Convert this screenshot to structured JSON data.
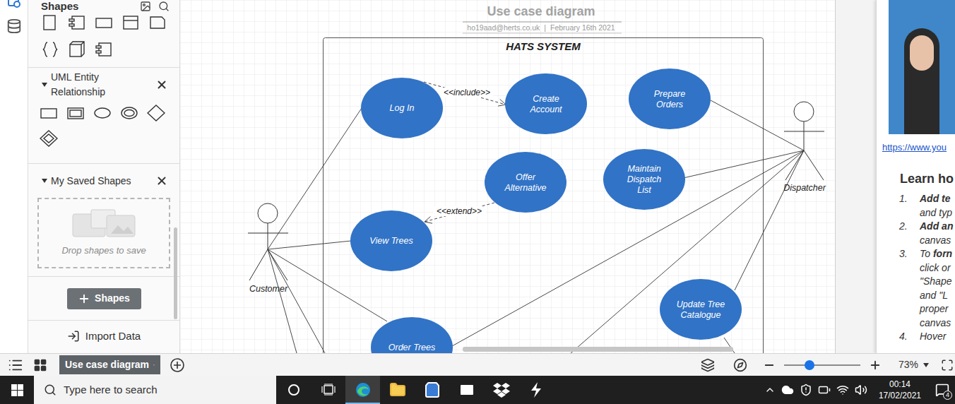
{
  "shapes_panel": {
    "title": "Shapes",
    "sections": [
      {
        "title": "UML Entity Relationship",
        "expanded": true
      },
      {
        "title": "My Saved Shapes",
        "expanded": true
      }
    ],
    "drop_zone": "Drop shapes to save",
    "add_button": "Shapes",
    "import": "Import Data"
  },
  "diagram": {
    "title": "Use case diagram",
    "author": "ho19aad@herts.co.uk",
    "separator": "|",
    "date": "February 16th 2021",
    "system": "HATS SYSTEM",
    "actors": [
      {
        "name": "Customer"
      },
      {
        "name": "Dispatcher"
      }
    ],
    "use_cases": [
      {
        "lines": [
          "Log In"
        ]
      },
      {
        "lines": [
          "Create",
          "Account"
        ]
      },
      {
        "lines": [
          "Prepare",
          "Orders"
        ]
      },
      {
        "lines": [
          "Offer",
          "Alternative"
        ]
      },
      {
        "lines": [
          "Maintain",
          "Dispatch",
          "List"
        ]
      },
      {
        "lines": [
          "View Trees"
        ]
      },
      {
        "lines": [
          "Update Tree",
          "Catalogue"
        ]
      },
      {
        "lines": [
          "Order Trees"
        ]
      }
    ],
    "relations": [
      {
        "kind": "include",
        "label": "<<include>>"
      },
      {
        "kind": "extend",
        "label": "<<extend>>"
      }
    ]
  },
  "right_panel": {
    "link": "https://www.you",
    "heading": "Learn ho",
    "steps": [
      {
        "number": "1.",
        "lines": [
          [
            {
              "text": "Add te",
              "bold": true
            }
          ],
          [
            {
              "text": "and typ",
              "bold": false
            }
          ]
        ]
      },
      {
        "number": "2.",
        "lines": [
          [
            {
              "text": "Add an",
              "bold": true
            }
          ],
          [
            {
              "text": "canvas",
              "bold": false
            }
          ]
        ]
      },
      {
        "number": "3.",
        "lines": [
          [
            {
              "text": "To ",
              "bold": false
            },
            {
              "text": "forn",
              "bold": true
            }
          ],
          [
            {
              "text": "click or",
              "bold": false
            }
          ],
          [
            {
              "text": "\"Shape",
              "bold": false
            }
          ],
          [
            {
              "text": "and \"L",
              "bold": false
            }
          ],
          [
            {
              "text": "proper",
              "bold": false
            }
          ],
          [
            {
              "text": "canvas",
              "bold": false
            }
          ]
        ]
      },
      {
        "number": "4.",
        "lines": [
          [
            {
              "text": "Hover",
              "bold": false
            }
          ]
        ]
      }
    ]
  },
  "bottom_bar": {
    "page_tab": "Use case diagram",
    "zoom": "73%",
    "zoom_level": 0.33
  },
  "taskbar": {
    "search_placeholder": "Type here to search",
    "apps": [
      {
        "kind": "cortana",
        "selected": false
      },
      {
        "kind": "taskview",
        "selected": false
      },
      {
        "kind": "edge",
        "selected": true
      },
      {
        "kind": "explorer",
        "selected": false
      },
      {
        "kind": "store",
        "selected": false
      },
      {
        "kind": "mail",
        "selected": false
      },
      {
        "kind": "dropbox",
        "selected": false
      },
      {
        "kind": "bolt",
        "selected": false
      }
    ],
    "time": "00:14",
    "date": "17/02/2021",
    "notifications": "4"
  }
}
